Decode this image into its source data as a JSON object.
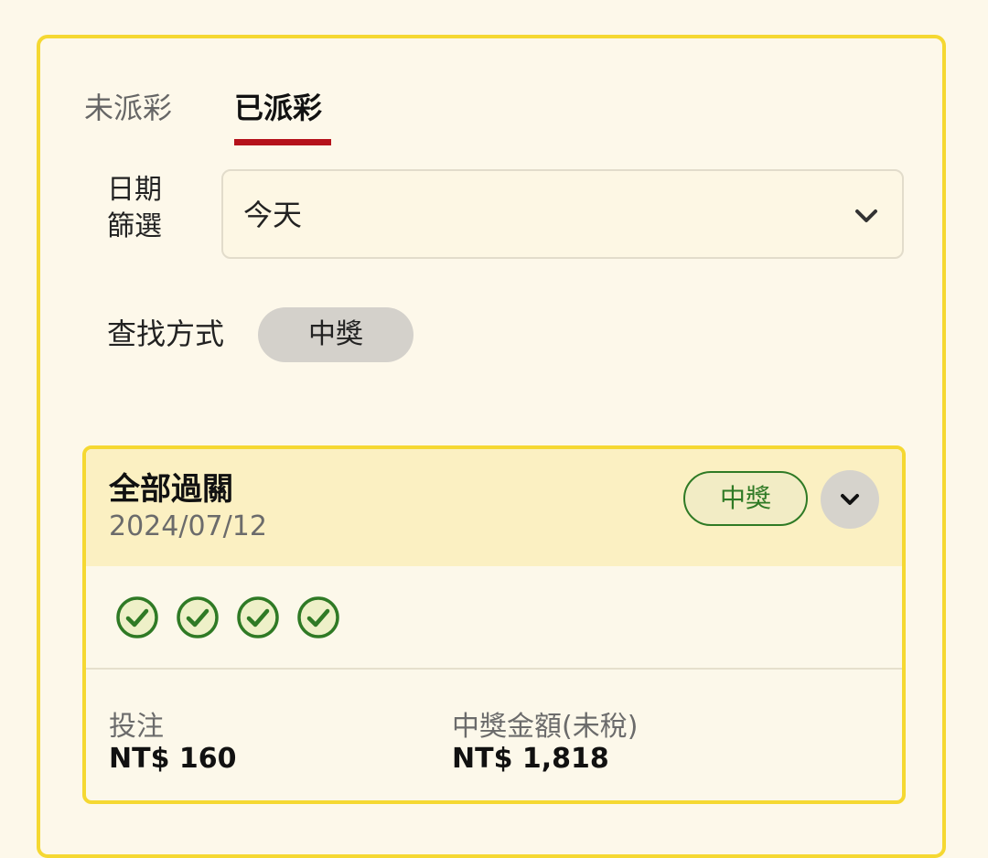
{
  "tabs": [
    {
      "label": "未派彩",
      "active": false
    },
    {
      "label": "已派彩",
      "active": true
    }
  ],
  "date_filter": {
    "label": "日期\n篩選",
    "label_line1": "日期",
    "label_line2": "篩選",
    "value": "今天"
  },
  "search": {
    "label": "查找方式",
    "chip": "中獎"
  },
  "bet_card": {
    "title": "全部過關",
    "date": "2024/07/12",
    "badge": "中獎",
    "legs_won": 4,
    "stake_label": "投注",
    "stake_value": "NT$ 160",
    "payout_label": "中獎金額(未稅)",
    "payout_value": "NT$ 1,818"
  },
  "colors": {
    "accent": "#f5d832",
    "tab_underline": "#b5121b",
    "win_green": "#2f7a25",
    "background": "#fdf8ea"
  },
  "icons": {
    "dropdown": "chevron-down-icon",
    "expand": "chevron-down-icon",
    "leg_result": "check-circle-icon"
  }
}
